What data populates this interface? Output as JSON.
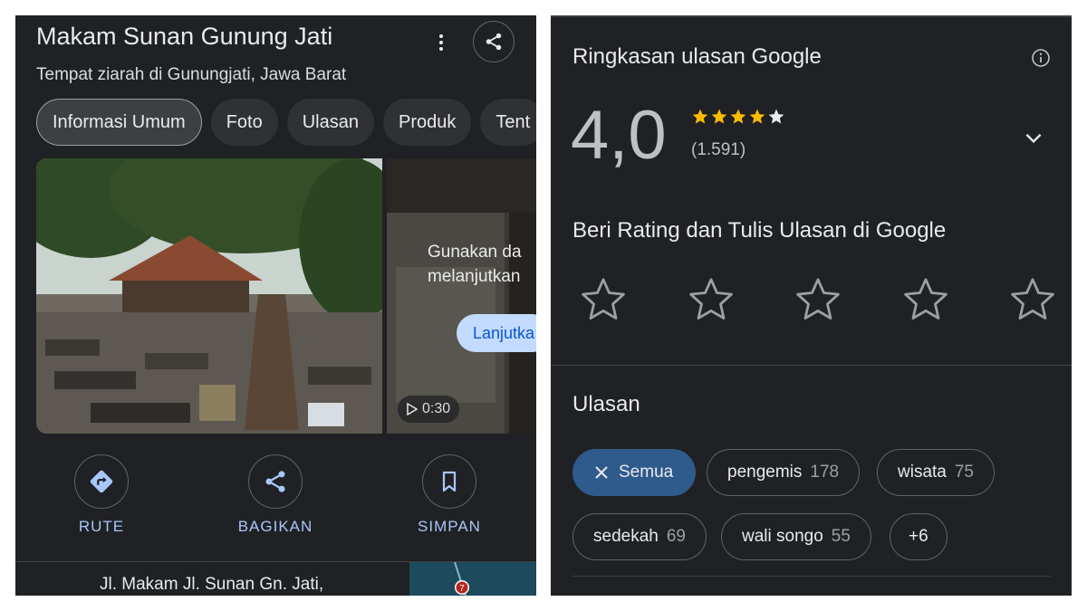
{
  "place": {
    "title": "Makam Sunan Gunung Jati",
    "subtitle": "Tempat ziarah di Gunungjati, Jawa Barat"
  },
  "tabs": [
    {
      "label": "Informasi Umum",
      "active": true
    },
    {
      "label": "Foto"
    },
    {
      "label": "Ulasan"
    },
    {
      "label": "Produk"
    },
    {
      "label": "Tent"
    }
  ],
  "video": {
    "overlay_line1": "Gunakan da",
    "overlay_line2": "melanjutkan",
    "continue_label": "Lanjutka",
    "duration": "0:30"
  },
  "actions": {
    "route_label": "RUTE",
    "share_label": "BAGIKAN",
    "save_label": "SIMPAN",
    "accent_color": "#a8c7fa"
  },
  "address": "Jl. Makam Jl. Sunan Gn. Jati,",
  "map_badge": "7",
  "summary": {
    "title": "Ringkasan ulasan Google",
    "rating": "4,0",
    "stars": 4,
    "review_count": "(1.591)",
    "star_color": "#fbbc04"
  },
  "rate": {
    "title": "Beri Rating dan Tulis Ulasan di Google"
  },
  "reviews": {
    "title": "Ulasan",
    "chips": [
      {
        "label": "Semua",
        "count": "",
        "selected": true
      },
      {
        "label": "pengemis",
        "count": "178"
      },
      {
        "label": "wisata",
        "count": "75"
      },
      {
        "label": "sedekah",
        "count": "69"
      },
      {
        "label": "wali songo",
        "count": "55"
      },
      {
        "label": "+6",
        "count": ""
      }
    ]
  }
}
